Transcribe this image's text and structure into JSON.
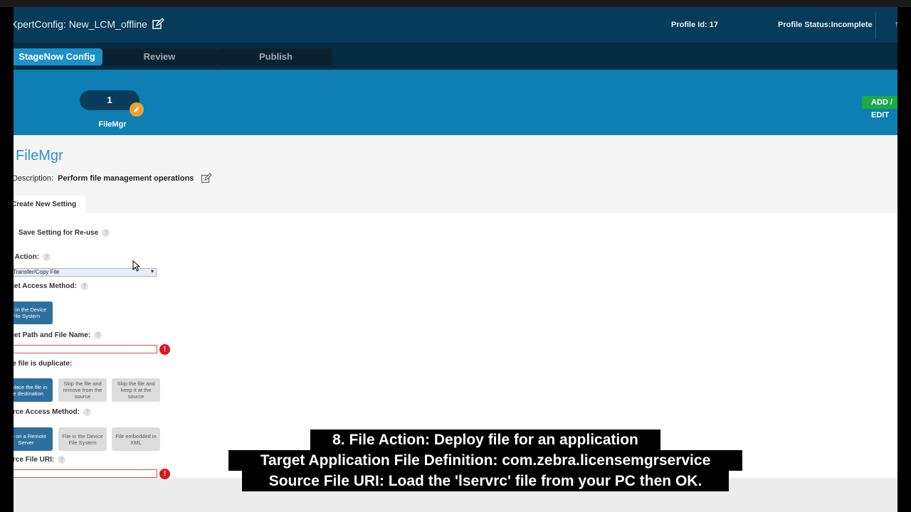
{
  "header": {
    "title": "XpertConfig: New_LCM_offline",
    "profile_id": "Profile Id: 17",
    "profile_status": "Profile Status:Incomplete"
  },
  "wizard": {
    "steps": [
      "StageNow Config",
      "Review",
      "Publish"
    ],
    "active_index": 0
  },
  "band": {
    "setting_number": "1",
    "setting_name": "FileMgr",
    "add_button": "ADD / EDIT"
  },
  "main": {
    "title": "FileMgr",
    "description_label": "Description:",
    "description_value": "Perform file management operations",
    "tab": "Create New Setting",
    "save_setting_label": "Save Setting for Re-use",
    "file_action_label": "File Action:",
    "file_action_value": "Transfer/Copy File",
    "target_access_label": "Target Access Method:",
    "target_access_option": "File in the Device File System",
    "target_path_label": "Target Path and File Name:",
    "duplicate_label": "If the file is duplicate:",
    "duplicate_options": [
      "Replace the file in the destination",
      "Skip the file and remove from the source",
      "Skip the file and keep it at the source"
    ],
    "source_access_label": "Source Access Method:",
    "source_access_options": [
      "File on a Remote Server",
      "File in the Device File System",
      "File embedded in XML"
    ],
    "source_uri_label": "Source File URI:",
    "help_glyph": "?",
    "error_glyph": "!"
  },
  "captions": [
    "8. File Action: Deploy file for an application",
    "Target Application File Definition: com.zebra.licensemgrservice",
    "Source File URI: Load the 'lservrc' file from your PC then OK."
  ],
  "colors": {
    "header_bg": "#063c5a",
    "active_step": "#1d8fc9",
    "band_bg": "#0d7fb3",
    "add_green": "#1faa45",
    "error_red": "#e0141e"
  }
}
